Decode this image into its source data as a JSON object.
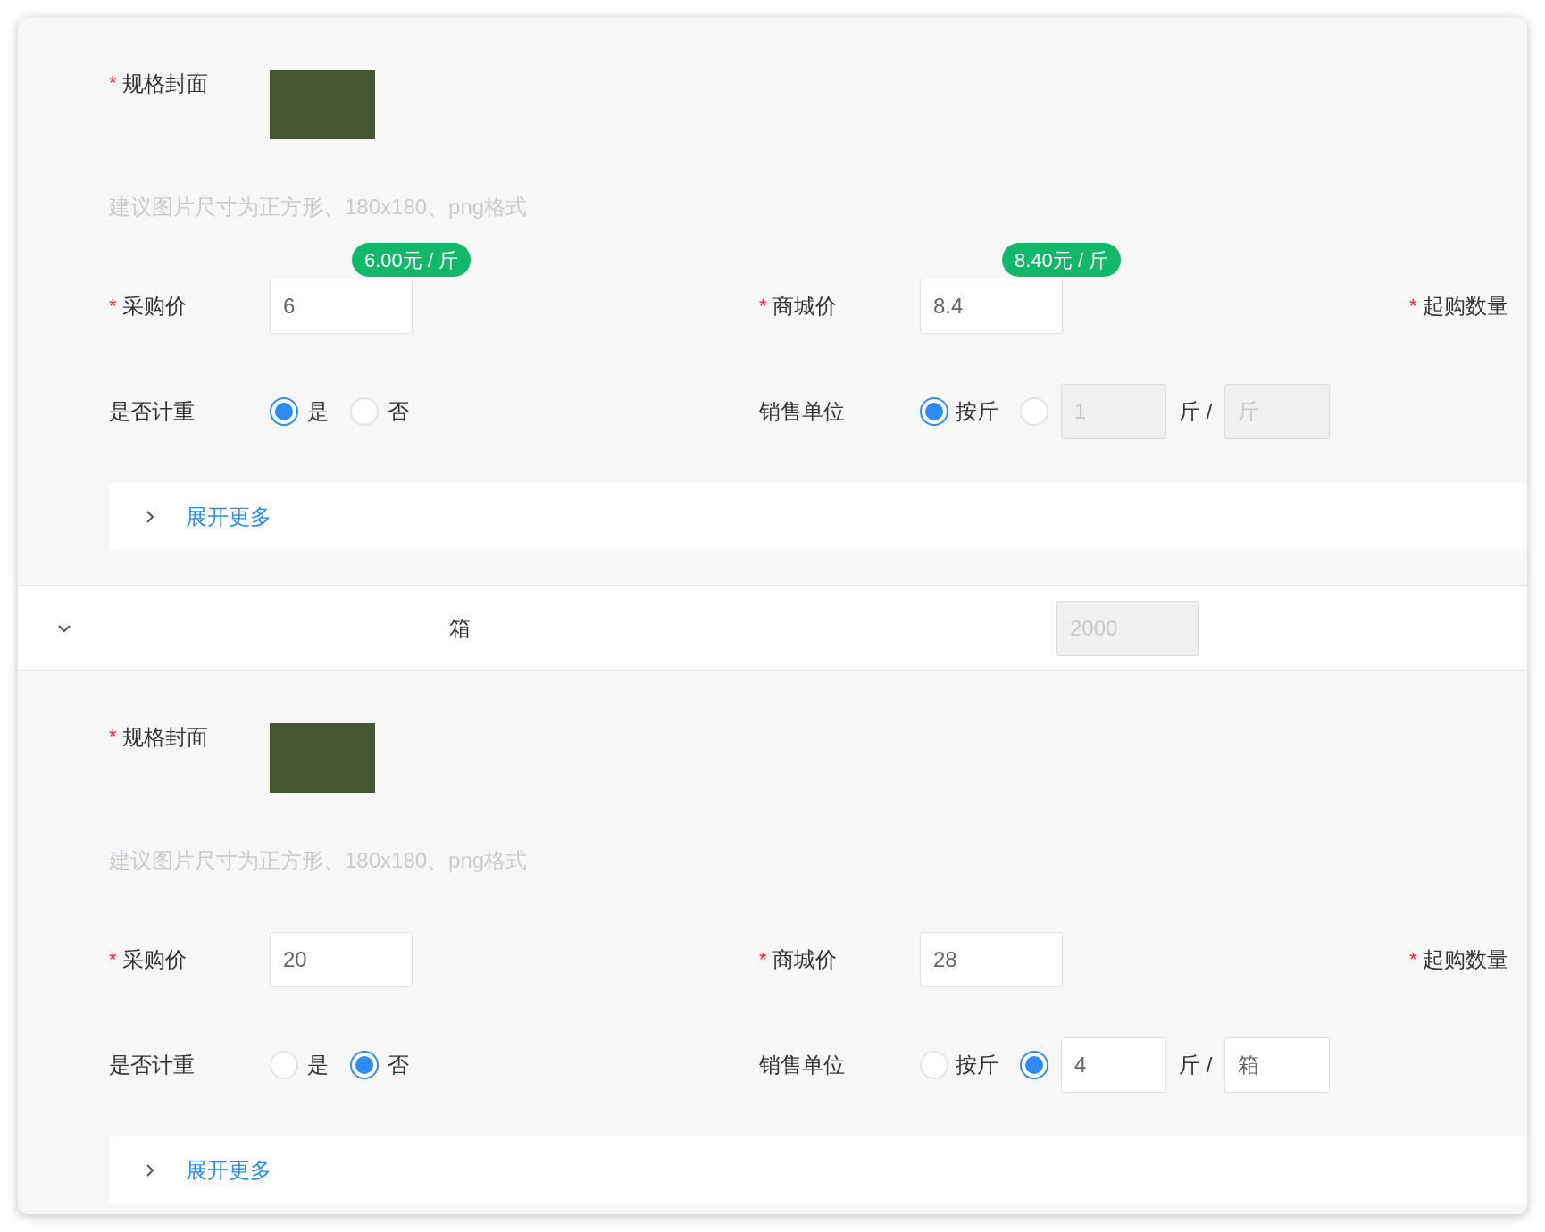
{
  "blocks": [
    {
      "kind": "spec",
      "cover": {
        "label": "规格封面",
        "required_mark": "*"
      },
      "hint": "建议图片尺寸为正方形、180x180、png格式",
      "prices": [
        {
          "label": "采购价",
          "required_mark": "*",
          "value": "6",
          "badge": "6.00元 / 斤"
        },
        {
          "label": "商城价",
          "required_mark": "*",
          "value": "8.4",
          "badge": "8.40元 / 斤"
        },
        {
          "label": "起购数量",
          "required_mark": "*"
        }
      ],
      "weighted": {
        "label": "是否计重",
        "options": [
          {
            "label": "是",
            "selected": true
          },
          {
            "label": "否",
            "selected": false
          }
        ]
      },
      "sale_unit": {
        "label": "销售单位",
        "options": [
          {
            "label": "按斤",
            "selected": true
          },
          {
            "selected": false
          }
        ],
        "qty": {
          "value": "1",
          "disabled": true
        },
        "separator": "斤 /",
        "unit": {
          "value": "斤",
          "disabled": true
        }
      },
      "more": {
        "label": "展开更多",
        "expanded": false
      }
    },
    {
      "kind": "header",
      "expanded": true,
      "name": "箱",
      "stock": {
        "value": "2000",
        "disabled": true
      }
    },
    {
      "kind": "spec",
      "cover": {
        "label": "规格封面",
        "required_mark": "*"
      },
      "hint": "建议图片尺寸为正方形、180x180、png格式",
      "prices": [
        {
          "label": "采购价",
          "required_mark": "*",
          "value": "20"
        },
        {
          "label": "商城价",
          "required_mark": "*",
          "value": "28"
        },
        {
          "label": "起购数量",
          "required_mark": "*"
        }
      ],
      "weighted": {
        "label": "是否计重",
        "options": [
          {
            "label": "是",
            "selected": false
          },
          {
            "label": "否",
            "selected": true
          }
        ]
      },
      "sale_unit": {
        "label": "销售单位",
        "options": [
          {
            "label": "按斤",
            "selected": false
          },
          {
            "selected": true
          }
        ],
        "qty": {
          "value": "4",
          "disabled": false
        },
        "separator": "斤 /",
        "unit": {
          "value": "箱",
          "disabled": false
        }
      },
      "more": {
        "label": "展开更多",
        "expanded": false
      }
    }
  ]
}
